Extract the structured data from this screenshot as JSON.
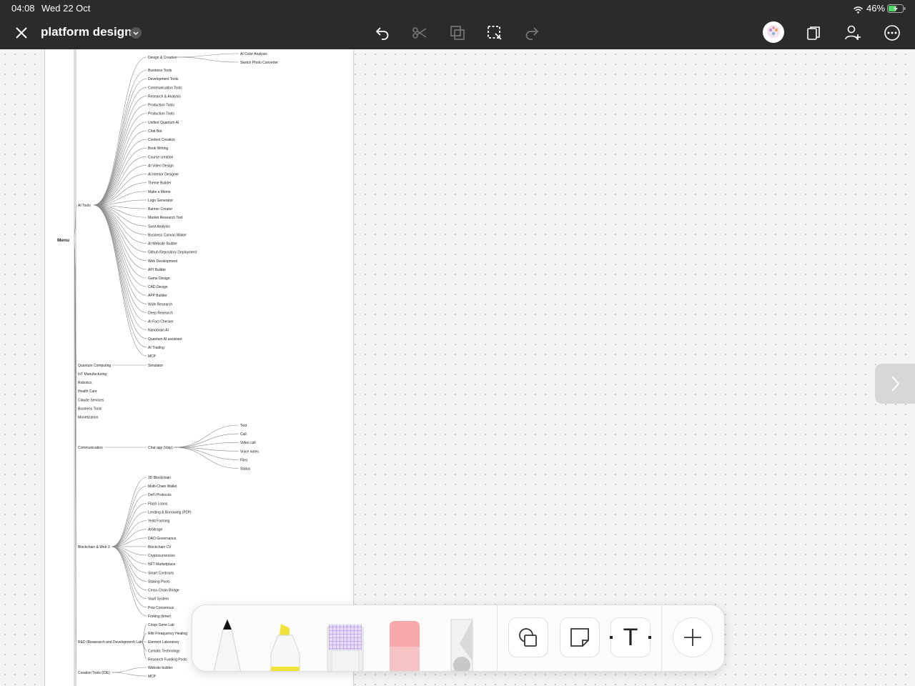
{
  "status_bar": {
    "time": "04:08",
    "date": "Wed 22 Oct",
    "battery": "46%"
  },
  "header": {
    "title": "platform design",
    "icons": [
      "close-icon",
      "chevron-down-icon",
      "undo-icon",
      "cut-icon",
      "duplicate-icon",
      "select-icon",
      "redo-icon",
      "avatar",
      "pages-icon",
      "add-user-icon",
      "more-icon"
    ]
  },
  "mindmap": {
    "root": "Menu",
    "ai_tools": {
      "label": "AI Tools",
      "design_creative": {
        "label": "Design & Creative",
        "children": [
          "AI Color Analysis",
          "Sketch Photo Converter"
        ]
      },
      "items": [
        "Business Tools",
        "Development  Tools",
        "Communication Tools",
        "Research & Analysis",
        "Production Tools",
        "Production Tools",
        "Unified Quantum AI",
        "Chat Bot",
        "Content Creation",
        "Book Writing",
        "Course creation",
        "AI Video Design",
        "AI Interior Designer",
        "Theme Builder",
        "Make a Meme",
        "Logo Generator",
        "Banner Creator",
        "Market Research Tool",
        "Swat Analysis",
        "Business Canvas Maker",
        "AI Website Builder",
        "Github Repository Deployment",
        "Web Development",
        "API Builder",
        "Game Design",
        "CAD Design",
        "APP Builder",
        "Wide Research",
        "Deep Research",
        "AI Fact Checker",
        "Nanobrain AI",
        "Quantum AI assistant",
        "AI Trading",
        "MCP"
      ]
    },
    "quantum": {
      "label": "Quantum Computing",
      "child": "Simulator"
    },
    "simple_items": [
      "IoT Manufacturing",
      "Robotics",
      "Health Care",
      "Claude Services",
      "Business Tools",
      "Monetization"
    ],
    "communication": {
      "label": "Communication",
      "chat": "Chat app (Voip)",
      "children": [
        "Text",
        "Call",
        "Video call",
        "Voice notes",
        "Files",
        "Status"
      ]
    },
    "blockchain": {
      "label": "Blockchain & Web 3",
      "children": [
        "3D Blockchain",
        "Multi-Chain Wallet",
        "DeFi Protocols",
        "Flash Loans",
        "Lending & Borrowing (P2P)",
        "Yeild Farming",
        "Arbitrage",
        "DAO Governance",
        "Blockchain CV",
        "Cryptocurrencies",
        "NFT Marketplace",
        "Smart Contracts",
        "Staking Pools",
        "Cross-Chain Bridge",
        "Vault System",
        "Pow Consensus",
        "Forking (timer)"
      ]
    },
    "rnd": {
      "label": "R&D (Reasearch and Development) Lab",
      "children": [
        "Crispr Gene Lab",
        "Rife Freaquency Healing",
        "Element Laboratory",
        "Cymatic Technology",
        "Research Funding Pools"
      ]
    },
    "creation_tools": {
      "label": "Creation Tools (IDE)",
      "children": [
        "Website builder",
        "MCP"
      ]
    }
  },
  "toolbar": {
    "tools": [
      "pen-tool",
      "highlighter-tool",
      "pattern-tool",
      "eraser-tool",
      "ruler-tool"
    ],
    "buttons": [
      "shapes-icon",
      "sticky-note-icon",
      "text-icon",
      "add-icon"
    ],
    "text_label": "T"
  }
}
